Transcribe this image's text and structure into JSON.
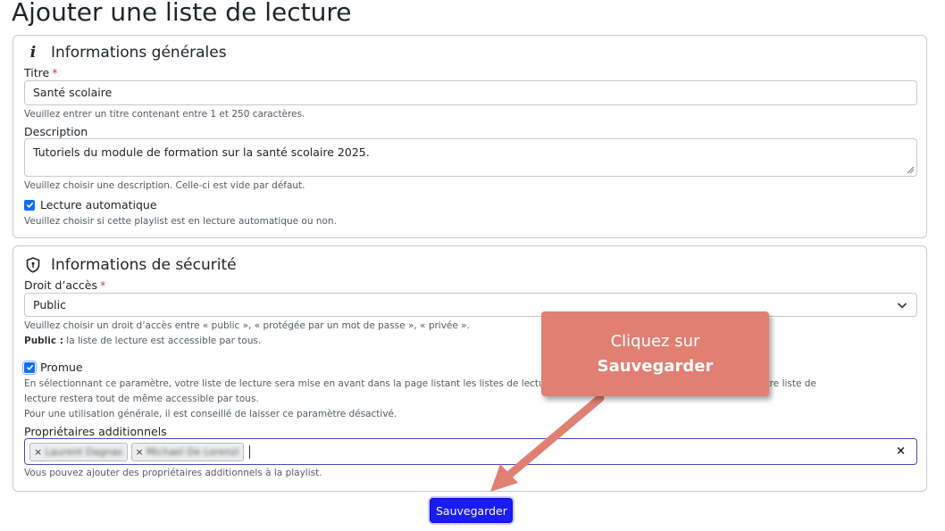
{
  "page": {
    "title": "Ajouter une liste de lecture"
  },
  "general": {
    "heading": "Informations générales",
    "title_label": "Titre",
    "required_mark": "*",
    "title_value": "Santé scolaire",
    "title_help": "Veuillez entrer un titre contenant entre 1 et 250 caractères.",
    "description_label": "Description",
    "description_value": "Tutoriels du module de formation sur la santé scolaire 2025.",
    "description_help": "Veuillez choisir une description. Celle-ci est vide par défaut.",
    "autoplay_label": "Lecture automatique",
    "autoplay_checked": true,
    "autoplay_help": "Veuillez choisir si cette playlist est en lecture automatique ou non."
  },
  "security": {
    "heading": "Informations de sécurité",
    "access_label": "Droit d’accès",
    "required_mark": "*",
    "access_value": "Public",
    "access_help": "Veuillez choisir un droit d’accès entre « public », « protégée par un mot de passe », « privée ».",
    "public_label": "Public :",
    "public_help": " la liste de lecture est accessible par tous.",
    "promoted_label": "Promue",
    "promoted_checked": true,
    "promoted_help_1": "En sélectionnant ce paramètre, votre liste de lecture sera mise en avant dans la page listant les listes de lecture publiques. Si ce paramètre est désactivé, votre liste de",
    "promoted_help_2": "lecture restera tout de même accessible par tous.",
    "promoted_help_3": "Pour une utilisation générale, il est conseillé de laisser ce paramètre désactivé.",
    "owners_label": "Propriétaires additionnels",
    "owners": [
      "Laurent Dagnas",
      "Michael De Lorenzi"
    ],
    "owners_clear": "×",
    "owners_help": "Vous pouvez ajouter des propriétaires additionnels à la playlist."
  },
  "actions": {
    "save_label": "Sauvegarder"
  },
  "callout": {
    "line1": "Cliquez sur",
    "line2": "Sauvegarder"
  },
  "icons": {
    "info": "info-icon",
    "security": "shield-icon",
    "select": "chevron-down-icon"
  },
  "colors": {
    "primary": "#1a1afa",
    "callout": "#e07f72",
    "required": "#dc3545"
  }
}
